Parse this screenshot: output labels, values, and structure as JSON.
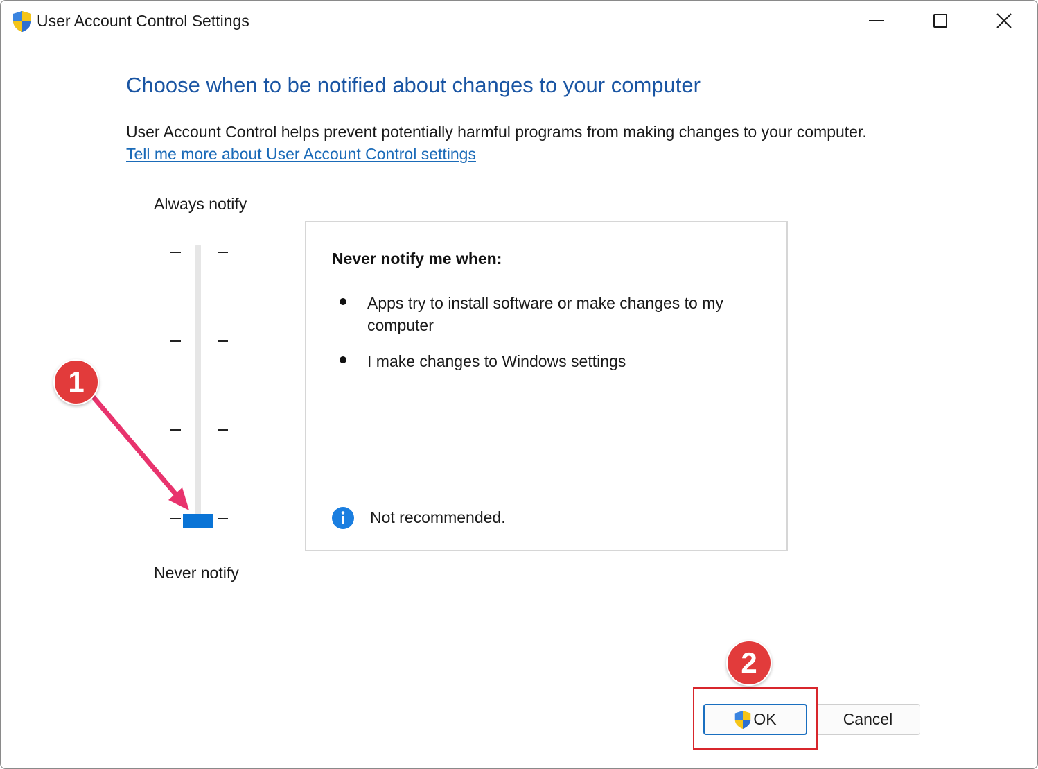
{
  "window": {
    "title": "User Account Control Settings",
    "icon": "uac-shield-icon"
  },
  "title_controls": {
    "minimize_symbol": "—",
    "maximize_icon": "maximize-icon",
    "close_icon": "close-icon"
  },
  "main": {
    "heading": "Choose when to be notified about changes to your computer",
    "description": "User Account Control helps prevent potentially harmful programs from making changes to your computer.",
    "help_link": "Tell me more about User Account Control settings"
  },
  "slider": {
    "top_label": "Always notify",
    "bottom_label": "Never notify",
    "levels": 4,
    "selected_level": 1
  },
  "panel": {
    "heading": "Never notify me when:",
    "bullets": [
      "Apps try to install software or make changes to my computer",
      "I make changes to Windows settings"
    ],
    "recommendation": "Not recommended.",
    "info_icon": "info-icon"
  },
  "buttons": {
    "ok_label": "OK",
    "cancel_label": "Cancel"
  },
  "annotations": {
    "badge_1": "1",
    "badge_2": "2"
  },
  "colors": {
    "heading": "#1a55a3",
    "link": "#1b6bb8",
    "slider_thumb": "#0a74d6",
    "annotation_red": "#e23b3b",
    "annotation_arrow": "#e8336d"
  }
}
